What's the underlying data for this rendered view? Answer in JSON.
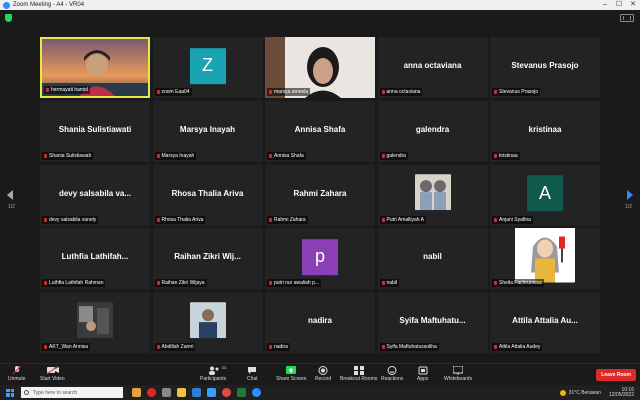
{
  "window": {
    "title": "Zoom Meeting - A4 - VR04",
    "minimize": "–",
    "maximize": "☐",
    "close": "✕"
  },
  "pagination": {
    "left": "1/2",
    "right": "1/2"
  },
  "tiles": [
    {
      "label": "hermayati hamid",
      "type": "video-person"
    },
    {
      "label": "zoom Eaa04",
      "type": "letter",
      "letter": "Z",
      "color": "#1aa3b3"
    },
    {
      "label": "marsya ameela",
      "type": "video-girl"
    },
    {
      "label": "anna octaviana",
      "type": "name",
      "big": "anna octaviana"
    },
    {
      "label": "Stevanus Prasojo",
      "type": "name",
      "big": "Stevanus Prasojo"
    },
    {
      "label": "Shania Sulistiawati",
      "type": "name",
      "big": "Shania Sulistiawati"
    },
    {
      "label": "Marsya Inayah",
      "type": "name",
      "big": "Marsya Inayah"
    },
    {
      "label": "Annisa Shafa",
      "type": "name",
      "big": "Annisa Shafa"
    },
    {
      "label": "galendra",
      "type": "name",
      "big": "galendra"
    },
    {
      "label": "kristinaa",
      "type": "name",
      "big": "kristinaa"
    },
    {
      "label": "devy salsabila vanely",
      "type": "name",
      "big": "devy salsabila va..."
    },
    {
      "label": "Rhosa Thalia Ariva",
      "type": "name",
      "big": "Rhosa Thalia Ariva"
    },
    {
      "label": "Rahmi Zahara",
      "type": "name",
      "big": "Rahmi Zahara"
    },
    {
      "label": "Putri Amalliyah A",
      "type": "photo-twins"
    },
    {
      "label": "Anjani Syafina",
      "type": "letter",
      "letter": "A",
      "color": "#0f5a4a"
    },
    {
      "label": "Luthfia Lathifah Rahman",
      "type": "name",
      "big": "Luthfia Lathifah..."
    },
    {
      "label": "Raihan Zikri Wijaya",
      "type": "name",
      "big": "Raihan Zikri Wij..."
    },
    {
      "label": "putri nur awaliah p...",
      "type": "letter",
      "letter": "p",
      "color": "#8a3fb5"
    },
    {
      "label": "nabil",
      "type": "name",
      "big": "nabil"
    },
    {
      "label": "Sheila Fachrunnisa",
      "type": "cartoon"
    },
    {
      "label": "AKT_Wan Annisa",
      "type": "photo-room"
    },
    {
      "label": "Abdillah Zamri",
      "type": "photo-man"
    },
    {
      "label": "nadira",
      "type": "name",
      "big": "nadira"
    },
    {
      "label": "Syifa Maftuhatussoliha",
      "type": "name",
      "big": "Syifa Maftuhatu..."
    },
    {
      "label": "Attila Attalia Audey",
      "type": "name",
      "big": "Attila Attalia Au..."
    }
  ],
  "toolbar": {
    "unmute": "Unmute",
    "start_video": "Start Video",
    "participants": "Participants",
    "participants_count": "33",
    "chat": "Chat",
    "share_screen": "Share Screen",
    "record": "Record",
    "breakout": "Breakout Rooms",
    "reactions": "Reactions",
    "apps": "Apps",
    "whiteboards": "Whiteboards",
    "leave": "Leave Room"
  },
  "taskbar": {
    "search_placeholder": "Type here to search",
    "weather": "31°C  Berawan",
    "time": "10:16",
    "date": "12/05/2022"
  }
}
